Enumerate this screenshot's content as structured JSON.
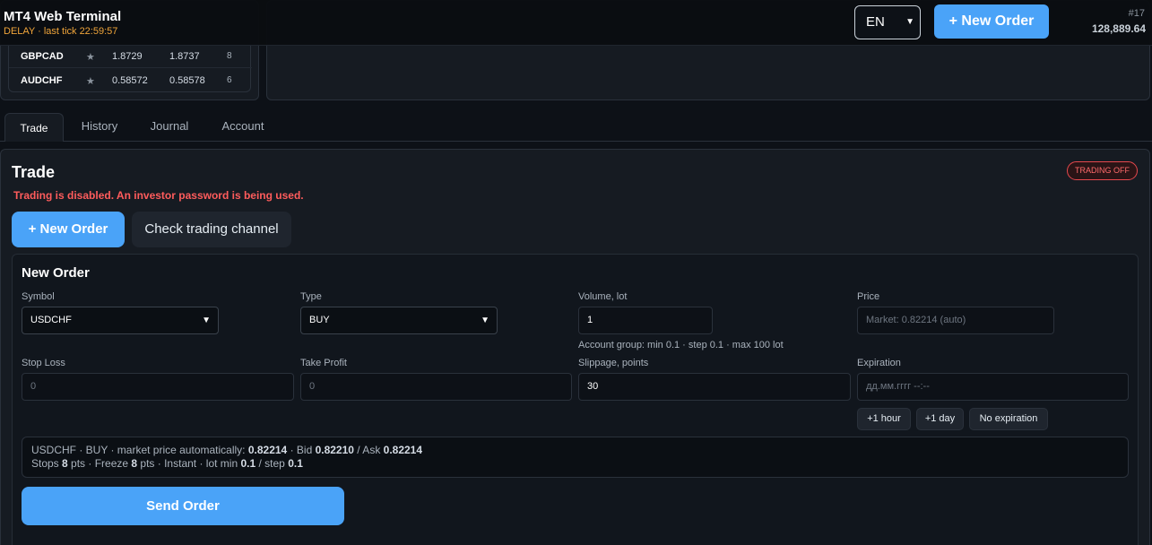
{
  "app": {
    "title": "MT4 Web Terminal",
    "status": "DELAY · last tick 22:59:57"
  },
  "header": {
    "language": "EN",
    "new_order_label": "+ New Order",
    "account_number": "#17",
    "balance": "128,889.64"
  },
  "quotes": [
    {
      "symbol": "GBPCAD",
      "star": "★",
      "bid": "1.8729",
      "ask": "1.8737",
      "spread": "8"
    },
    {
      "symbol": "AUDCHF",
      "star": "★",
      "bid": "0.58572",
      "ask": "0.58578",
      "spread": "6"
    }
  ],
  "tabs": [
    "Trade",
    "History",
    "Journal",
    "Account"
  ],
  "trade": {
    "title": "Trade",
    "status_badge": "TRADING OFF",
    "warning": "Trading is disabled. An investor password is being used.",
    "new_order_label": "+ New Order",
    "check_channel_label": "Check trading channel"
  },
  "form": {
    "title": "New Order",
    "symbol": {
      "label": "Symbol",
      "value": "USDCHF"
    },
    "type": {
      "label": "Type",
      "value": "BUY"
    },
    "volume": {
      "label": "Volume, lot",
      "value": "1",
      "hint": "Account group: min 0.1 · step 0.1 · max 100 lot"
    },
    "price": {
      "label": "Price",
      "placeholder": "Market: 0.82214 (auto)"
    },
    "stop_loss": {
      "label": "Stop Loss",
      "placeholder": "0"
    },
    "take_profit": {
      "label": "Take Profit",
      "placeholder": "0"
    },
    "slippage": {
      "label": "Slippage, points",
      "value": "30"
    },
    "expiration": {
      "label": "Expiration",
      "placeholder": "дд.мм.гггг --:--"
    },
    "exp_buttons": [
      "+1 hour",
      "+1 day",
      "No expiration"
    ],
    "summary": {
      "prefix": "USDCHF · BUY · market price automatically: ",
      "market_price": "0.82214",
      "bid_label": " · Bid ",
      "bid": "0.82210",
      "ask_label": " / Ask ",
      "ask": "0.82214",
      "stops_label": "Stops ",
      "stops": "8",
      "freeze_label": " pts · Freeze ",
      "freeze": "8",
      "lot_label": " pts · Instant · lot min ",
      "lot_min": "0.1",
      "step_label": " / step ",
      "lot_step": "0.1"
    },
    "send_label": "Send Order"
  }
}
